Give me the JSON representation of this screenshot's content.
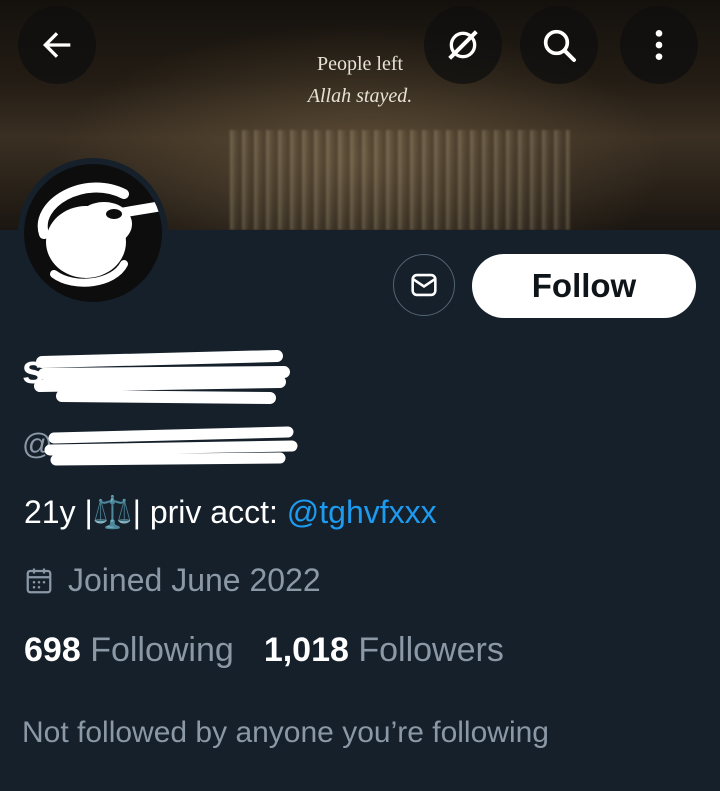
{
  "banner": {
    "line1": "People left",
    "line2": "Allah stayed."
  },
  "header": {
    "back_icon": "arrow-left-icon",
    "grok_icon": "grok-icon",
    "search_icon": "search-icon",
    "more_icon": "more-vertical-icon"
  },
  "profile": {
    "name_visible": "s",
    "handle_visible": "@",
    "bio_text": "21y |⚖️| priv acct: ",
    "bio_mention": "@tghvfxxx",
    "joined": "Joined June 2022",
    "following_count": "698",
    "following_label": "Following",
    "followers_count": "1,018",
    "followers_label": "Followers",
    "not_followed": "Not followed by anyone you’re following"
  },
  "actions": {
    "message_icon": "envelope-icon",
    "follow_label": "Follow"
  },
  "colors": {
    "background": "#15202b",
    "muted": "#8b98a5",
    "accent": "#1d9bf0",
    "follow_bg": "#ffffff"
  }
}
